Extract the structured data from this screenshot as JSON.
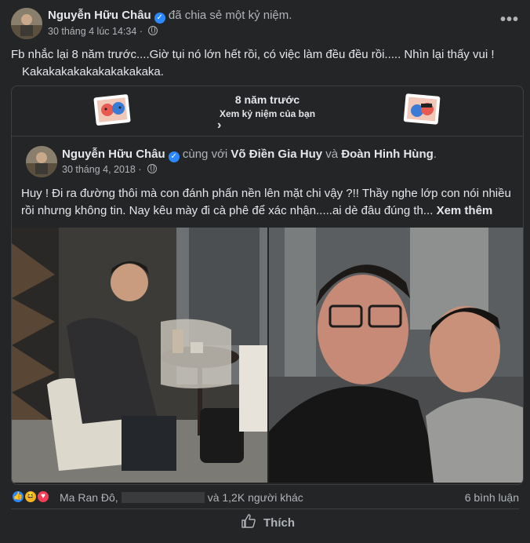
{
  "post": {
    "author": "Nguyễn Hữu Châu",
    "action": "đã chia sẻ một kỷ niệm.",
    "timestamp": "30 tháng 4 lúc 14:34",
    "separator": "·",
    "text_line1": "Fb nhắc lại 8 năm trước....Giờ tụi nó lớn hết rồi, có việc làm đều đều rồi..... Nhìn lại thấy vui !",
    "text_line2": "Kakakakakakakakakakaka."
  },
  "memory": {
    "title": "8 năm trước",
    "subtitle": "Xem kỷ niệm của bạn",
    "shared_post": {
      "author": "Nguyễn Hữu Châu",
      "with_word": "cùng với",
      "tag1": "Võ Điền Gia Huy",
      "and_word": "và",
      "tag2": "Đoàn Hinh Hùng",
      "end": ".",
      "date": "30 tháng 4, 2018",
      "separator": "·",
      "text": "Huy ! Đi ra đường thôi mà con đánh phấn nền lên mặt chi vậy ?!! Thầy nghe lớp con nói nhiều rồi nhưng không tin. Nay kêu mày đi cà phê để xác nhận.....ai dè đâu đúng th...",
      "see_more": "Xem thêm"
    }
  },
  "reactions": {
    "first_name": "Ma Ran Đô,",
    "others": "và 1,2K người khác",
    "comments": "6 bình luận"
  },
  "actions": {
    "like": "Thích"
  },
  "colors": {
    "background": "#242526",
    "text": "#e4e6eb",
    "muted": "#b0b3b8",
    "accent": "#2d88ff",
    "border": "#3e4042"
  },
  "icons": [
    "verified-badge-icon",
    "globe-icon",
    "more-options-icon",
    "chevron-right-icon",
    "like-reaction-icon",
    "haha-reaction-icon",
    "love-reaction-icon",
    "like-thumb-icon"
  ]
}
